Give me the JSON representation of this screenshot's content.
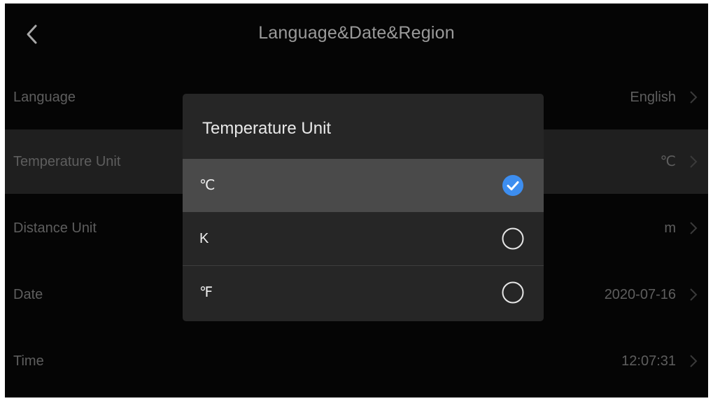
{
  "header": {
    "title": "Language&Date&Region",
    "back_icon": "chevron-left-icon"
  },
  "settings": {
    "rows": [
      {
        "label": "Language",
        "value": "English"
      },
      {
        "label": "Temperature Unit",
        "value": "℃"
      },
      {
        "label": "Distance Unit",
        "value": "m"
      },
      {
        "label": "Date",
        "value": "2020-07-16"
      },
      {
        "label": "Time",
        "value": "12:07:31"
      }
    ],
    "selected_row": "Temperature Unit"
  },
  "dialog": {
    "title": "Temperature Unit",
    "options": [
      {
        "label": "℃",
        "checked": true
      },
      {
        "label": "K",
        "checked": false
      },
      {
        "label": "℉",
        "checked": false
      }
    ]
  },
  "colors": {
    "accent": "#3d8ef0",
    "background": "#050505",
    "dialog": "#262626"
  }
}
